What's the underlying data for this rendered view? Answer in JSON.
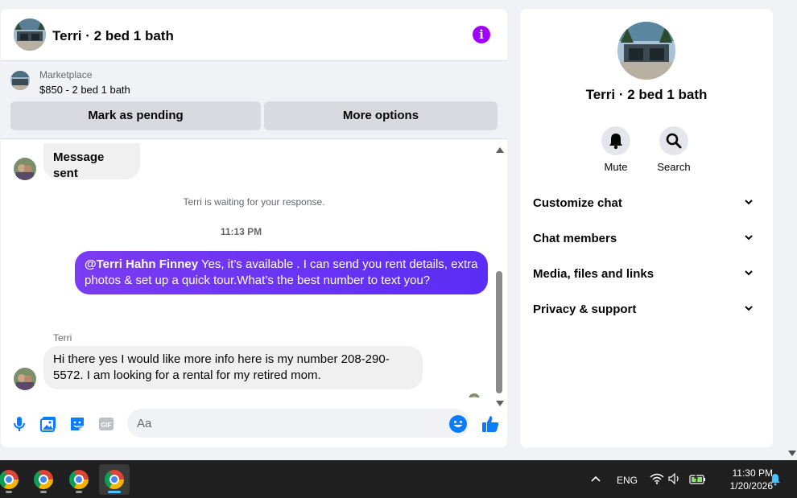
{
  "chat": {
    "title": "Terri · 2 bed 1 bath",
    "info_icon": "info-icon",
    "marketplace": {
      "label": "Marketplace",
      "price_title": "$850 - 2 bed 1 bath",
      "pending_button": "Mark as pending",
      "more_button": "More options"
    },
    "messages": {
      "sent_status": "Message sent",
      "waiting": "Terri is waiting for your response.",
      "timestamp": "11:13 PM",
      "outgoing_mention": "@Terri Hahn Finney",
      "outgoing_text": " Yes, it’s available .  I can send you rent details, extra photos & set up a quick tour.What’s the best number to text you?",
      "sender_name": "Terri",
      "incoming_text": "Hi there yes I would like more info here is my number 208-290-5572. I am looking for a rental for my retired mom."
    },
    "composer": {
      "placeholder": "Aa",
      "icons": [
        "microphone-icon",
        "photo-icon",
        "sticker-icon",
        "gif-icon",
        "emoji-icon",
        "thumbs-up-icon"
      ],
      "gif_label": "GIF"
    }
  },
  "side_panel": {
    "title": "Terri · 2 bed 1 bath",
    "actions": [
      {
        "label": "Mute",
        "icon": "bell-icon"
      },
      {
        "label": "Search",
        "icon": "search-icon"
      }
    ],
    "sections": [
      {
        "label": "Customize chat"
      },
      {
        "label": "Chat members"
      },
      {
        "label": "Media, files and links"
      },
      {
        "label": "Privacy & support"
      }
    ]
  },
  "taskbar": {
    "language": "ENG",
    "time": "11:30 PM",
    "date": "1/20/2026"
  },
  "colors": {
    "accent": "#a100ff",
    "outgoing_bubble": "#5b2df5",
    "messenger_blue": "#0a7cff",
    "taskbar": "#1f1f1f"
  }
}
